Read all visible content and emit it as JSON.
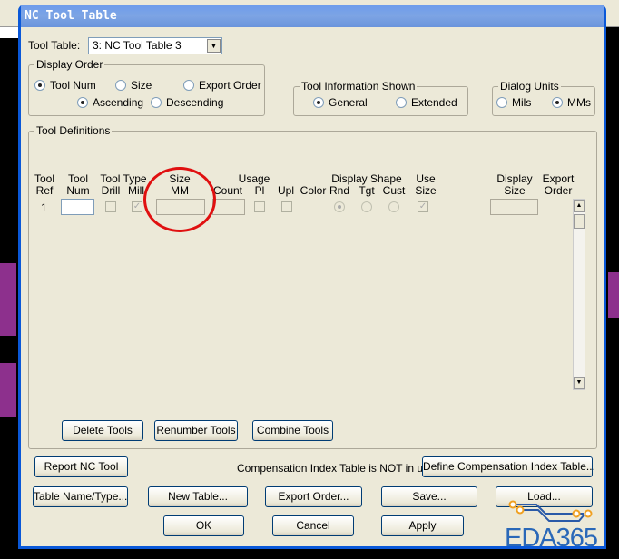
{
  "window": {
    "title": "NC Tool Table"
  },
  "tool_table": {
    "label": "Tool Table:",
    "value": "3: NC Tool Table 3"
  },
  "display_order": {
    "label": "Display Order",
    "options": [
      "Tool Num",
      "Size",
      "Export Order"
    ],
    "selected": "Tool Num",
    "direction": [
      "Ascending",
      "Descending"
    ],
    "direction_selected": "Ascending"
  },
  "tool_info": {
    "label": "Tool Information Shown",
    "options": [
      "General",
      "Extended"
    ],
    "selected": "General"
  },
  "dialog_units": {
    "label": "Dialog Units",
    "options": [
      "Mils",
      "MMs"
    ],
    "selected": "MMs"
  },
  "tool_definitions": {
    "label": "Tool Definitions",
    "headers": {
      "tool_ref": "Tool\nRef",
      "tool_num": "Tool\nNum",
      "tool_type": "Tool Type",
      "drill": "Drill",
      "mill": "Mill",
      "size": "Size\nMM",
      "usage": "Usage",
      "count": "Count",
      "pl": "Pl",
      "upl": "Upl",
      "color": "Color",
      "display_shape": "Display Shape",
      "rnd": "Rnd",
      "tgt": "Tgt",
      "cust": "Cust",
      "use_size": "Use\nSize",
      "display_size": "Display\nSize",
      "export_order": "Export\nOrder"
    },
    "rows": [
      {
        "ref": "1"
      }
    ]
  },
  "buttons": {
    "delete_tools": "Delete Tools",
    "renumber_tools": "Renumber Tools",
    "combine_tools": "Combine Tools",
    "report": "Report NC Tool",
    "define_comp": "Define Compensation Index Table...",
    "table_name": "Table Name/Type...",
    "new_table": "New Table...",
    "export_order": "Export Order...",
    "save": "Save...",
    "load": "Load...",
    "ok": "OK",
    "cancel": "Cancel",
    "apply": "Apply"
  },
  "compensation_status": "Compensation Index Table is NOT in use:",
  "watermark": "EDA365"
}
